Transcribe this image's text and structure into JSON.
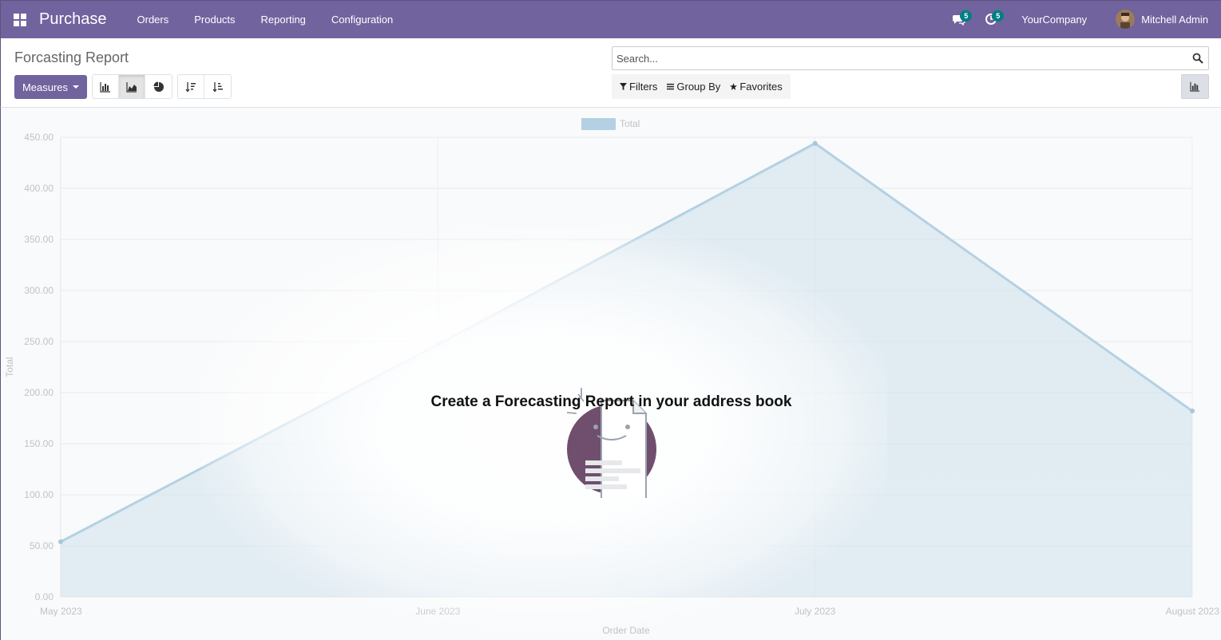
{
  "navbar": {
    "app_name": "Purchase",
    "menu": [
      "Orders",
      "Products",
      "Reporting",
      "Configuration"
    ],
    "messages_badge": "5",
    "activities_badge": "5",
    "company": "YourCompany",
    "user": "Mitchell Admin"
  },
  "control_panel": {
    "breadcrumb": "Forcasting Report",
    "measures_label": "Measures",
    "search_placeholder": "Search...",
    "filters_label": "Filters",
    "group_by_label": "Group By",
    "favorites_label": "Favorites"
  },
  "chart_data": {
    "type": "area",
    "categories": [
      "May 2023",
      "June 2023",
      "July 2023",
      "August 2023"
    ],
    "series": [
      {
        "name": "Total",
        "values": [
          54,
          247,
          444,
          182
        ]
      }
    ],
    "xlabel": "Order Date",
    "ylabel": "Total",
    "ylim": [
      0,
      450
    ],
    "yticks": [
      "0.00",
      "50.00",
      "100.00",
      "150.00",
      "200.00",
      "250.00",
      "300.00",
      "350.00",
      "400.00",
      "450.00"
    ],
    "legend_position": "top-center",
    "grid": true,
    "series_color": "#b4d1e3"
  },
  "helper": {
    "title": "Create a Forecasting Report in your address book"
  }
}
